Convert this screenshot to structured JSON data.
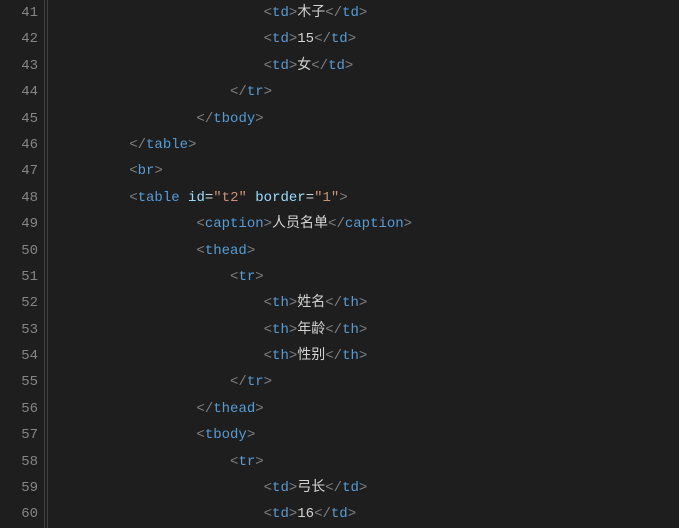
{
  "lineStart": 41,
  "lines": [
    {
      "indent": 6,
      "parts": [
        {
          "t": "bracket",
          "v": "<"
        },
        {
          "t": "tag",
          "v": "td"
        },
        {
          "t": "bracket",
          "v": ">"
        },
        {
          "t": "text",
          "v": "木子"
        },
        {
          "t": "bracket",
          "v": "</"
        },
        {
          "t": "tag",
          "v": "td"
        },
        {
          "t": "bracket",
          "v": ">"
        }
      ]
    },
    {
      "indent": 6,
      "parts": [
        {
          "t": "bracket",
          "v": "<"
        },
        {
          "t": "tag",
          "v": "td"
        },
        {
          "t": "bracket",
          "v": ">"
        },
        {
          "t": "text",
          "v": "15"
        },
        {
          "t": "bracket",
          "v": "</"
        },
        {
          "t": "tag",
          "v": "td"
        },
        {
          "t": "bracket",
          "v": ">"
        }
      ]
    },
    {
      "indent": 6,
      "parts": [
        {
          "t": "bracket",
          "v": "<"
        },
        {
          "t": "tag",
          "v": "td"
        },
        {
          "t": "bracket",
          "v": ">"
        },
        {
          "t": "text",
          "v": "女"
        },
        {
          "t": "bracket",
          "v": "</"
        },
        {
          "t": "tag",
          "v": "td"
        },
        {
          "t": "bracket",
          "v": ">"
        }
      ]
    },
    {
      "indent": 5,
      "parts": [
        {
          "t": "bracket",
          "v": "</"
        },
        {
          "t": "tag",
          "v": "tr"
        },
        {
          "t": "bracket",
          "v": ">"
        }
      ]
    },
    {
      "indent": 4,
      "parts": [
        {
          "t": "bracket",
          "v": "</"
        },
        {
          "t": "tag",
          "v": "tbody"
        },
        {
          "t": "bracket",
          "v": ">"
        }
      ]
    },
    {
      "indent": 2,
      "parts": [
        {
          "t": "bracket",
          "v": "</"
        },
        {
          "t": "tag",
          "v": "table"
        },
        {
          "t": "bracket",
          "v": ">"
        }
      ]
    },
    {
      "indent": 2,
      "parts": [
        {
          "t": "bracket",
          "v": "<"
        },
        {
          "t": "tag",
          "v": "br"
        },
        {
          "t": "bracket",
          "v": ">"
        }
      ]
    },
    {
      "indent": 2,
      "parts": [
        {
          "t": "bracket",
          "v": "<"
        },
        {
          "t": "tag",
          "v": "table"
        },
        {
          "t": "text",
          "v": " "
        },
        {
          "t": "attr-name",
          "v": "id"
        },
        {
          "t": "eq",
          "v": "="
        },
        {
          "t": "attr-val",
          "v": "\"t2\""
        },
        {
          "t": "text",
          "v": " "
        },
        {
          "t": "attr-name",
          "v": "border"
        },
        {
          "t": "eq",
          "v": "="
        },
        {
          "t": "attr-val",
          "v": "\"1\""
        },
        {
          "t": "bracket",
          "v": ">"
        }
      ]
    },
    {
      "indent": 4,
      "parts": [
        {
          "t": "bracket",
          "v": "<"
        },
        {
          "t": "tag",
          "v": "caption"
        },
        {
          "t": "bracket",
          "v": ">"
        },
        {
          "t": "text",
          "v": "人员名单"
        },
        {
          "t": "bracket",
          "v": "</"
        },
        {
          "t": "tag",
          "v": "caption"
        },
        {
          "t": "bracket",
          "v": ">"
        }
      ]
    },
    {
      "indent": 4,
      "parts": [
        {
          "t": "bracket",
          "v": "<"
        },
        {
          "t": "tag",
          "v": "thead"
        },
        {
          "t": "bracket",
          "v": ">"
        }
      ]
    },
    {
      "indent": 5,
      "parts": [
        {
          "t": "bracket",
          "v": "<"
        },
        {
          "t": "tag",
          "v": "tr"
        },
        {
          "t": "bracket",
          "v": ">"
        }
      ]
    },
    {
      "indent": 6,
      "parts": [
        {
          "t": "bracket",
          "v": "<"
        },
        {
          "t": "tag",
          "v": "th"
        },
        {
          "t": "bracket",
          "v": ">"
        },
        {
          "t": "text",
          "v": "姓名"
        },
        {
          "t": "bracket",
          "v": "</"
        },
        {
          "t": "tag",
          "v": "th"
        },
        {
          "t": "bracket",
          "v": ">"
        }
      ]
    },
    {
      "indent": 6,
      "parts": [
        {
          "t": "bracket",
          "v": "<"
        },
        {
          "t": "tag",
          "v": "th"
        },
        {
          "t": "bracket",
          "v": ">"
        },
        {
          "t": "text",
          "v": "年龄"
        },
        {
          "t": "bracket",
          "v": "</"
        },
        {
          "t": "tag",
          "v": "th"
        },
        {
          "t": "bracket",
          "v": ">"
        }
      ]
    },
    {
      "indent": 6,
      "parts": [
        {
          "t": "bracket",
          "v": "<"
        },
        {
          "t": "tag",
          "v": "th"
        },
        {
          "t": "bracket",
          "v": ">"
        },
        {
          "t": "text",
          "v": "性别"
        },
        {
          "t": "bracket",
          "v": "</"
        },
        {
          "t": "tag",
          "v": "th"
        },
        {
          "t": "bracket",
          "v": ">"
        }
      ]
    },
    {
      "indent": 5,
      "parts": [
        {
          "t": "bracket",
          "v": "</"
        },
        {
          "t": "tag",
          "v": "tr"
        },
        {
          "t": "bracket",
          "v": ">"
        }
      ]
    },
    {
      "indent": 4,
      "parts": [
        {
          "t": "bracket",
          "v": "</"
        },
        {
          "t": "tag",
          "v": "thead"
        },
        {
          "t": "bracket",
          "v": ">"
        }
      ]
    },
    {
      "indent": 4,
      "parts": [
        {
          "t": "bracket",
          "v": "<"
        },
        {
          "t": "tag",
          "v": "tbody"
        },
        {
          "t": "bracket",
          "v": ">"
        }
      ]
    },
    {
      "indent": 5,
      "parts": [
        {
          "t": "bracket",
          "v": "<"
        },
        {
          "t": "tag",
          "v": "tr"
        },
        {
          "t": "bracket",
          "v": ">"
        }
      ]
    },
    {
      "indent": 6,
      "parts": [
        {
          "t": "bracket",
          "v": "<"
        },
        {
          "t": "tag",
          "v": "td"
        },
        {
          "t": "bracket",
          "v": ">"
        },
        {
          "t": "text",
          "v": "弓长"
        },
        {
          "t": "bracket",
          "v": "</"
        },
        {
          "t": "tag",
          "v": "td"
        },
        {
          "t": "bracket",
          "v": ">"
        }
      ]
    },
    {
      "indent": 6,
      "parts": [
        {
          "t": "bracket",
          "v": "<"
        },
        {
          "t": "tag",
          "v": "td"
        },
        {
          "t": "bracket",
          "v": ">"
        },
        {
          "t": "text",
          "v": "16"
        },
        {
          "t": "bracket",
          "v": "</"
        },
        {
          "t": "tag",
          "v": "td"
        },
        {
          "t": "bracket",
          "v": ">"
        }
      ]
    }
  ],
  "indentUnit": "    "
}
